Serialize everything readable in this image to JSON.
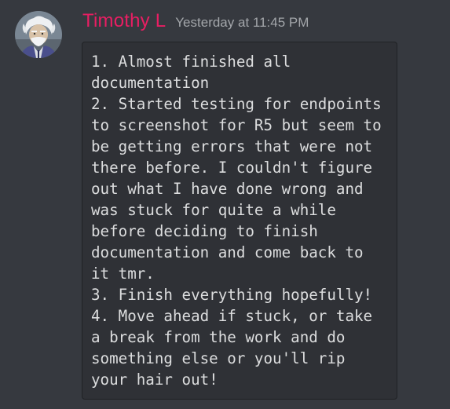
{
  "message": {
    "avatar": {
      "alt": "Timothy L avatar",
      "colors": {
        "bg": "#7a8794",
        "hair": "#eef0f2",
        "skin": "#d8c2a8",
        "suit": "#4a4f8c",
        "shirt": "#dcdfe3"
      }
    },
    "author": "Timothy L",
    "timestamp": "Yesterday at 11:45 PM",
    "code_lines": [
      "1. Almost finished all",
      "documentation",
      "2. Started testing for endpoints",
      "to screenshot for R5 but seem to",
      "be getting errors that were not",
      "there before. I couldn't figure",
      "out what I have done wrong and",
      "was stuck for quite a while",
      "before deciding to finish",
      "documentation and come back to",
      "it tmr.",
      "3. Finish everything hopefully!",
      "4. Move ahead if stuck, or take",
      "a break from the work and do",
      "something else or you'll rip",
      "your hair out!"
    ]
  },
  "colors": {
    "background": "#36393f",
    "username": "#e91e63",
    "timestamp": "#a3a6aa",
    "code_background": "#2f3136",
    "code_text": "#dcddde"
  }
}
